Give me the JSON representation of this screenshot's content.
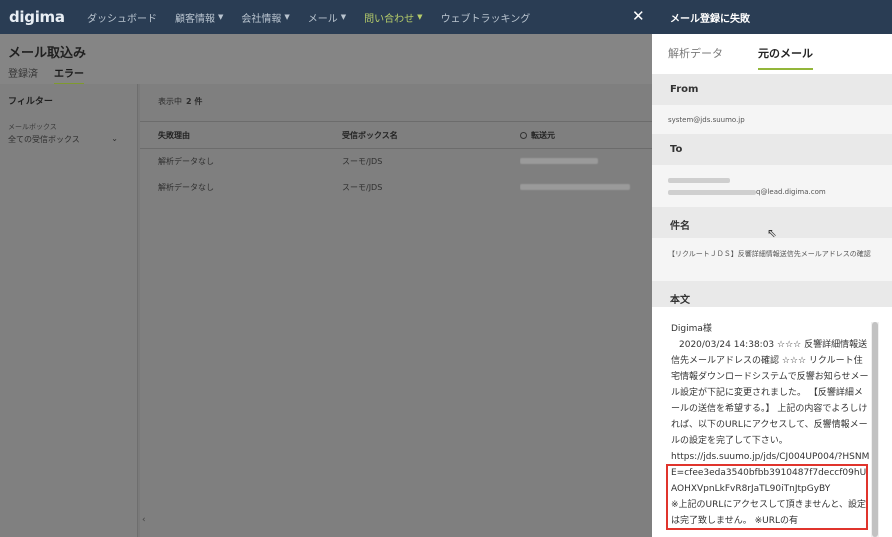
{
  "nav": {
    "logo": "digima",
    "items": [
      {
        "label": "ダッシュボード",
        "caret": false,
        "active": false
      },
      {
        "label": "顧客情報",
        "caret": true,
        "active": false
      },
      {
        "label": "会社情報",
        "caret": true,
        "active": false
      },
      {
        "label": "メール",
        "caret": true,
        "active": false
      },
      {
        "label": "問い合わせ",
        "caret": true,
        "active": true
      },
      {
        "label": "ウェブトラッキング",
        "caret": false,
        "active": false
      }
    ],
    "close_symbol": "✕"
  },
  "page": {
    "title": "メール取込み",
    "tabs": [
      {
        "label": "登録済"
      },
      {
        "label": "エラー",
        "active": true
      }
    ]
  },
  "filter": {
    "title": "フィルター",
    "mailbox_label": "メールボックス",
    "mailbox_value": "全ての受信ボックス"
  },
  "table": {
    "count_label": "表示中",
    "count_value": "2 件",
    "headers": [
      "失敗理由",
      "受信ボックス名",
      "転送元"
    ],
    "rows": [
      {
        "reason": "解析データなし",
        "inbox": "スーモ/JDS"
      },
      {
        "reason": "解析データなし",
        "inbox": "スーモ/JDS"
      }
    ]
  },
  "drawer": {
    "title": "メール登録に失敗",
    "tabs": [
      "解析データ",
      "元のメール"
    ],
    "from_label": "From",
    "from_value": "system@jds.suumo.jp",
    "to_label": "To",
    "to_value_suffix": "q@lead.digima.com",
    "subject_label": "件名",
    "subject_value": "【リクルートＪＤＳ】反響詳細情報送信先メールアドレスの確認",
    "body_label": "本文",
    "body": {
      "greeting": "Digima様",
      "paragraph": "2020/03/24 14:38:03 ☆☆☆ 反響詳細情報送信先メールアドレスの確認 ☆☆☆ リクルート住宅情報ダウンロードシステムで反響お知らせメール設定が下記に変更されました。 【反響詳細メールの送信を希望する。】 上記の内容でよろしければ、以下のURLにアクセスして、反響情報メールの設定を完了して下さい。",
      "url": "https://jds.suumo.jp/jds/CJ004UP004/?HSNME=cfee3eda3540bfbb3910487f7deccf09hUAOHXVpnLkFvR8rJaTL90iTnJtpGyBY",
      "trailing": "※上記のURLにアクセスして頂きませんと、設定は完了致しません。 ※URLの有"
    }
  },
  "colors": {
    "nav_bg": "#2a3d54",
    "accent_green": "#93b63a",
    "highlight_red": "#e0342c"
  }
}
